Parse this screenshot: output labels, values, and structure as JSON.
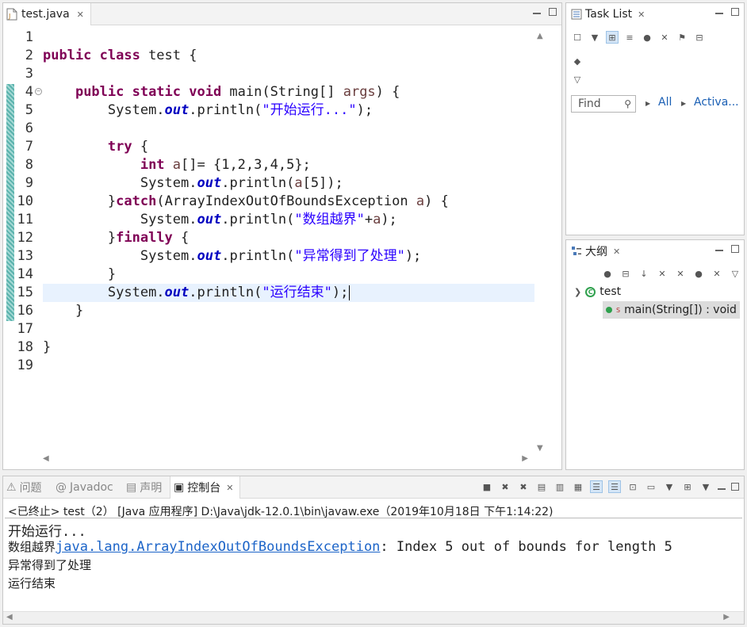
{
  "editor": {
    "tab_label": "test.java",
    "line_numbers": [
      "1",
      "2",
      "3",
      "4",
      "5",
      "6",
      "7",
      "8",
      "9",
      "10",
      "11",
      "12",
      "13",
      "14",
      "15",
      "16",
      "17",
      "18",
      "19"
    ],
    "code": {
      "l2_kw": "public class",
      "l2_rest": " test {",
      "l4_kw": "public static void",
      "l4_mid": " main(String[] ",
      "l4_var": "args",
      "l4_end": ") {",
      "sys": "System.",
      "out": "out",
      "println": ".println(",
      "l5_str": "\"开始运行...\"",
      "end_paren": ");",
      "l7_kw": "try",
      "l7_end": " {",
      "l8_kw": "int",
      "l8_var": " a",
      "l8_rest": "[]= {1,2,3,4,5};",
      "l9_var": "a",
      "l9_rest": "[5]);",
      "l10_start": "}",
      "l10_kw": "catch",
      "l10_mid": "(ArrayIndexOutOfBoundsException ",
      "l10_var": "a",
      "l10_end": ") {",
      "l11_str": "\"数组越界\"",
      "l11_plus": "+",
      "l11_var": "a",
      "l12_start": "}",
      "l12_kw": "finally",
      "l12_end": " {",
      "l13_str": "\"异常得到了处理\"",
      "close_brace": "}",
      "l15_str": "\"运行结束\"",
      "l15_end": ");"
    }
  },
  "task_list": {
    "title": "Task List",
    "find_placeholder": "Find",
    "all_label": "All",
    "activate_label": "Activa..."
  },
  "outline": {
    "title": "大纲",
    "class_name": "test",
    "method_label": "main(String[]) : void",
    "static_marker": "S"
  },
  "console": {
    "tabs": [
      "问题",
      "Javadoc",
      "声明",
      "控制台"
    ],
    "status": "<已终止> test（2）  [Java 应用程序] D:\\Java\\jdk-12.0.1\\bin\\javaw.exe（2019年10月18日 下午1:14:22)",
    "out_line1": "开始运行...",
    "out_line2_prefix": "数组越界",
    "out_line2_link": "java.lang.ArrayIndexOutOfBoundsException",
    "out_line2_rest": ": Index 5 out of bounds for length 5",
    "out_line3": "异常得到了处理",
    "out_line4": "运行结束"
  },
  "icons": {
    "close": "✕",
    "java_file": "java-file-icon",
    "search": "search-icon"
  },
  "colors": {
    "keyword": "#7f0055",
    "string": "#2a00ff",
    "field": "#0000c0",
    "local_var": "#6a3e3e",
    "current_line": "#e8f2fe",
    "link": "#1c64c8"
  }
}
